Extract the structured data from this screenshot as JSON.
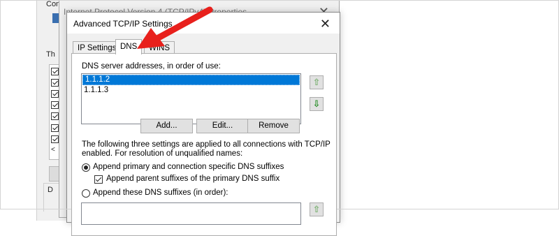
{
  "background_window": {
    "label_fragment": "Connect using:",
    "section_fragment": "Th",
    "group_fragment": "D"
  },
  "ipv4_window": {
    "title": "Internet Protocol Version 4 (TCP/IPv4) Properties"
  },
  "dialog": {
    "title": "Advanced TCP/IP Settings",
    "close_glyph": "✕",
    "tabs": [
      {
        "label": "IP Settings",
        "active": false
      },
      {
        "label": "DNS",
        "active": true
      },
      {
        "label": "WINS",
        "active": false
      }
    ],
    "dns": {
      "list_label": "DNS server addresses, in order of use:",
      "servers": [
        "1.1.1.2",
        "1.1.1.3"
      ],
      "selected_index": 0,
      "buttons": {
        "add": "Add...",
        "edit": "Edit...",
        "remove": "Remove"
      },
      "info_text_line1": "The following three settings are applied to all connections with TCP/IP",
      "info_text_line2": "enabled. For resolution of unqualified names:",
      "option_primary": "Append primary and connection specific DNS suffixes",
      "option_parent": "Append parent suffixes of the primary DNS suffix",
      "option_these": "Append these DNS suffixes (in order):",
      "primary_selected": true,
      "parent_checked": true
    }
  },
  "colors": {
    "selection": "#0078d7",
    "annotation_arrow": "#e8201c",
    "move_up_arrow": "#78b06f",
    "move_down_arrow": "#1f8a1f"
  }
}
